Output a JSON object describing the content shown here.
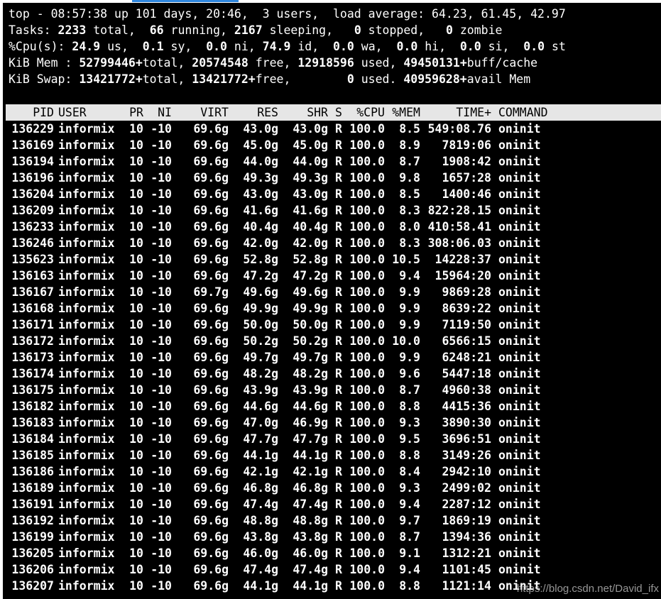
{
  "summary": {
    "uptime_line": "top - 08:57:38 up 101 days, 20:46,  3 users,  load average: 64.23, 61.45, 42.97",
    "tasks": {
      "prefix": "Tasks: ",
      "total": "2233",
      "total_suffix": " total,  ",
      "running": "66",
      "running_suffix": " running, ",
      "sleeping": "2167",
      "sleeping_suffix": " sleeping,   ",
      "stopped": "0",
      "stopped_suffix": " stopped,   ",
      "zombie": "0",
      "zombie_suffix": " zombie"
    },
    "cpu": {
      "prefix": "%Cpu(s): ",
      "us": "24.9",
      "us_suffix": " us,  ",
      "sy": "0.1",
      "sy_suffix": " sy,  ",
      "ni": "0.0",
      "ni_suffix": " ni, ",
      "id": "74.9",
      "id_suffix": " id,  ",
      "wa": "0.0",
      "wa_suffix": " wa,  ",
      "hi": "0.0",
      "hi_suffix": " hi,  ",
      "si": "0.0",
      "si_suffix": " si,  ",
      "st": "0.0",
      "st_suffix": " st"
    },
    "mem": {
      "prefix": "KiB Mem : ",
      "total": "52799446+",
      "total_suffix": "total, ",
      "free": "20574548",
      "free_suffix": " free, ",
      "used": "12918596",
      "used_suffix": " used, ",
      "buff": "49450131+",
      "buff_suffix": "buff/cache"
    },
    "swap": {
      "prefix": "KiB Swap: ",
      "total": "13421772+",
      "total_suffix": "total, ",
      "free": "13421772+",
      "free_suffix": "free,        ",
      "used": "0",
      "used_suffix": " used. ",
      "avail": "40959628+",
      "avail_suffix": "avail Mem"
    }
  },
  "columns": [
    "PID",
    "USER",
    "PR",
    "NI",
    "VIRT",
    "RES",
    "SHR",
    "S",
    "%CPU",
    "%MEM",
    "TIME+",
    "COMMAND"
  ],
  "processes": [
    [
      "136229",
      "informix",
      "10",
      "-10",
      "69.6g",
      "43.0g",
      "43.0g",
      "R",
      "100.0",
      "8.5",
      "549:08.76",
      "oninit"
    ],
    [
      "136169",
      "informix",
      "10",
      "-10",
      "69.6g",
      "45.0g",
      "45.0g",
      "R",
      "100.0",
      "8.9",
      "7819:06",
      "oninit"
    ],
    [
      "136194",
      "informix",
      "10",
      "-10",
      "69.6g",
      "44.0g",
      "44.0g",
      "R",
      "100.0",
      "8.7",
      "1908:42",
      "oninit"
    ],
    [
      "136196",
      "informix",
      "10",
      "-10",
      "69.6g",
      "49.3g",
      "49.3g",
      "R",
      "100.0",
      "9.8",
      "1657:28",
      "oninit"
    ],
    [
      "136204",
      "informix",
      "10",
      "-10",
      "69.6g",
      "43.0g",
      "43.0g",
      "R",
      "100.0",
      "8.5",
      "1400:46",
      "oninit"
    ],
    [
      "136209",
      "informix",
      "10",
      "-10",
      "69.6g",
      "41.6g",
      "41.6g",
      "R",
      "100.0",
      "8.3",
      "822:28.15",
      "oninit"
    ],
    [
      "136233",
      "informix",
      "10",
      "-10",
      "69.6g",
      "40.4g",
      "40.4g",
      "R",
      "100.0",
      "8.0",
      "410:58.41",
      "oninit"
    ],
    [
      "136246",
      "informix",
      "10",
      "-10",
      "69.6g",
      "42.0g",
      "42.0g",
      "R",
      "100.0",
      "8.3",
      "308:06.03",
      "oninit"
    ],
    [
      "135623",
      "informix",
      "10",
      "-10",
      "69.6g",
      "52.8g",
      "52.8g",
      "R",
      "100.0",
      "10.5",
      "14228:37",
      "oninit"
    ],
    [
      "136163",
      "informix",
      "10",
      "-10",
      "69.6g",
      "47.2g",
      "47.2g",
      "R",
      "100.0",
      "9.4",
      "15964:20",
      "oninit"
    ],
    [
      "136167",
      "informix",
      "10",
      "-10",
      "69.7g",
      "49.6g",
      "49.6g",
      "R",
      "100.0",
      "9.9",
      "9869:28",
      "oninit"
    ],
    [
      "136168",
      "informix",
      "10",
      "-10",
      "69.6g",
      "49.9g",
      "49.9g",
      "R",
      "100.0",
      "9.9",
      "8639:22",
      "oninit"
    ],
    [
      "136171",
      "informix",
      "10",
      "-10",
      "69.6g",
      "50.0g",
      "50.0g",
      "R",
      "100.0",
      "9.9",
      "7119:50",
      "oninit"
    ],
    [
      "136172",
      "informix",
      "10",
      "-10",
      "69.6g",
      "50.2g",
      "50.2g",
      "R",
      "100.0",
      "10.0",
      "6566:15",
      "oninit"
    ],
    [
      "136173",
      "informix",
      "10",
      "-10",
      "69.6g",
      "49.7g",
      "49.7g",
      "R",
      "100.0",
      "9.9",
      "6248:21",
      "oninit"
    ],
    [
      "136174",
      "informix",
      "10",
      "-10",
      "69.6g",
      "48.2g",
      "48.2g",
      "R",
      "100.0",
      "9.6",
      "5447:18",
      "oninit"
    ],
    [
      "136175",
      "informix",
      "10",
      "-10",
      "69.6g",
      "43.9g",
      "43.9g",
      "R",
      "100.0",
      "8.7",
      "4960:38",
      "oninit"
    ],
    [
      "136182",
      "informix",
      "10",
      "-10",
      "69.6g",
      "44.6g",
      "44.6g",
      "R",
      "100.0",
      "8.8",
      "4415:36",
      "oninit"
    ],
    [
      "136183",
      "informix",
      "10",
      "-10",
      "69.6g",
      "47.0g",
      "46.9g",
      "R",
      "100.0",
      "9.3",
      "3890:30",
      "oninit"
    ],
    [
      "136184",
      "informix",
      "10",
      "-10",
      "69.6g",
      "47.7g",
      "47.7g",
      "R",
      "100.0",
      "9.5",
      "3696:51",
      "oninit"
    ],
    [
      "136185",
      "informix",
      "10",
      "-10",
      "69.6g",
      "44.1g",
      "44.1g",
      "R",
      "100.0",
      "8.8",
      "3149:26",
      "oninit"
    ],
    [
      "136186",
      "informix",
      "10",
      "-10",
      "69.6g",
      "42.1g",
      "42.1g",
      "R",
      "100.0",
      "8.4",
      "2942:10",
      "oninit"
    ],
    [
      "136189",
      "informix",
      "10",
      "-10",
      "69.6g",
      "46.8g",
      "46.8g",
      "R",
      "100.0",
      "9.3",
      "2499:02",
      "oninit"
    ],
    [
      "136191",
      "informix",
      "10",
      "-10",
      "69.6g",
      "47.4g",
      "47.4g",
      "R",
      "100.0",
      "9.4",
      "2287:12",
      "oninit"
    ],
    [
      "136192",
      "informix",
      "10",
      "-10",
      "69.6g",
      "48.8g",
      "48.8g",
      "R",
      "100.0",
      "9.7",
      "1869:19",
      "oninit"
    ],
    [
      "136199",
      "informix",
      "10",
      "-10",
      "69.6g",
      "43.8g",
      "43.8g",
      "R",
      "100.0",
      "8.7",
      "1394:36",
      "oninit"
    ],
    [
      "136205",
      "informix",
      "10",
      "-10",
      "69.6g",
      "46.0g",
      "46.0g",
      "R",
      "100.0",
      "9.1",
      "1312:21",
      "oninit"
    ],
    [
      "136206",
      "informix",
      "10",
      "-10",
      "69.6g",
      "47.4g",
      "47.4g",
      "R",
      "100.0",
      "9.4",
      "1101:45",
      "oninit"
    ],
    [
      "136207",
      "informix",
      "10",
      "-10",
      "69.6g",
      "44.1g",
      "44.1g",
      "R",
      "100.0",
      "8.8",
      "1121:14",
      "oninit"
    ]
  ],
  "watermark": "https://blog.csdn.net/David_ifx",
  "colors": {
    "terminal_bg": "#000000",
    "text": "#ffffff",
    "header_bg": "#e6e6e6",
    "header_text": "#000000",
    "tab_accent": "#2e86de"
  }
}
